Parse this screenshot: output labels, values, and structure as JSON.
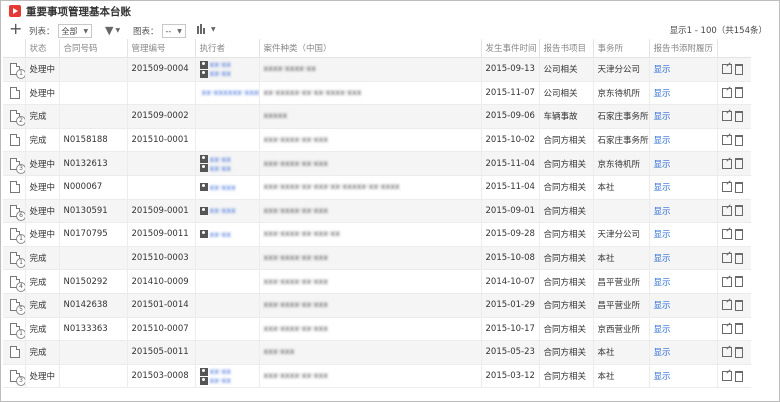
{
  "window": {
    "title": "重要事项管理基本台账"
  },
  "toolbar": {
    "list_label": "列表：",
    "list_value": "全部",
    "chart_label": "图表：",
    "chart_value": "--",
    "pagination": "显示1 - 100（共154条）"
  },
  "columns": [
    "状态",
    "合同号码",
    "管理编号",
    "执行者",
    "案件种类（中国）",
    "发生事件时间",
    "报告书项目",
    "事务所",
    "报告书添附履历"
  ],
  "rows": [
    {
      "badge": "1",
      "status": "处理中",
      "contract": "",
      "mgmt": "201509-0004",
      "execs": [
        "xx·xx",
        "xx·xx"
      ],
      "case": "xxxx·xxxx·xx",
      "date": "2015-09-13",
      "report": "公司相关",
      "office": "天津分公司",
      "attach": "显示"
    },
    {
      "badge": "",
      "status": "处理中",
      "contract": "",
      "mgmt": "",
      "execs": [
        "xx·xxxxxx·xxxxx"
      ],
      "case": "xx·xxxxx·xx·xx·xxxx·xxx",
      "date": "2015-11-07",
      "report": "公司相关",
      "office": "京东待机所",
      "attach": "显示"
    },
    {
      "badge": "2",
      "status": "完成",
      "contract": "",
      "mgmt": "201509-0002",
      "execs": [],
      "case": "xxxxx",
      "date": "2015-09-06",
      "report": "车辆事故",
      "office": "石家庄事务所",
      "attach": "显示"
    },
    {
      "badge": "",
      "status": "完成",
      "contract": "N0158188",
      "mgmt": "201510-0001",
      "execs": [],
      "case": "xxx·xxxx·xx·xxx",
      "date": "2015-10-02",
      "report": "合同方相关",
      "office": "石家庄事务所",
      "attach": "显示"
    },
    {
      "badge": "3",
      "status": "处理中",
      "contract": "N0132613",
      "mgmt": "",
      "execs": [
        "xx·xx",
        "xx·xx"
      ],
      "case": "xxx·xxxx·xx·xxx",
      "date": "2015-11-04",
      "report": "合同方相关",
      "office": "京东待机所",
      "attach": "显示"
    },
    {
      "badge": "",
      "status": "处理中",
      "contract": "N000067",
      "mgmt": "",
      "execs": [
        "xx·xxx"
      ],
      "case": "xxx·xxxx·xx·xxx·xx·xxxxx·xx·xxxx",
      "date": "2015-11-04",
      "report": "合同方相关",
      "office": "本社",
      "attach": "显示"
    },
    {
      "badge": "6",
      "status": "处理中",
      "contract": "N0130591",
      "mgmt": "201509-0001",
      "execs": [
        "xx·xxx"
      ],
      "case": "xxx·xxxx·xx·xxx",
      "date": "2015-09-01",
      "report": "合同方相关",
      "office": "",
      "attach": "显示"
    },
    {
      "badge": "1",
      "status": "处理中",
      "contract": "N0170795",
      "mgmt": "201509-0011",
      "execs": [
        "xx·xx"
      ],
      "case": "xxx·xxxx·xx·xxx·xx",
      "date": "2015-09-28",
      "report": "合同方相关",
      "office": "天津分公司",
      "attach": "显示"
    },
    {
      "badge": "1",
      "status": "完成",
      "contract": "",
      "mgmt": "201510-0003",
      "execs": [],
      "case": "xxx·xxxx·xx·xxx",
      "date": "2015-10-08",
      "report": "合同方相关",
      "office": "本社",
      "attach": "显示"
    },
    {
      "badge": "4",
      "status": "完成",
      "contract": "N0150292",
      "mgmt": "201410-0009",
      "execs": [],
      "case": "xxx·xxxx·xx·xxx",
      "date": "2014-10-07",
      "report": "合同方相关",
      "office": "昌平营业所",
      "attach": "显示"
    },
    {
      "badge": "5",
      "status": "完成",
      "contract": "N0142638",
      "mgmt": "201501-0014",
      "execs": [],
      "case": "xxx·xxxx·xx·xxx",
      "date": "2015-01-29",
      "report": "合同方相关",
      "office": "昌平营业所",
      "attach": "显示"
    },
    {
      "badge": "1",
      "status": "完成",
      "contract": "N0133363",
      "mgmt": "201510-0007",
      "execs": [],
      "case": "xxx·xxxx·xx·xxx",
      "date": "2015-10-17",
      "report": "合同方相关",
      "office": "京西营业所",
      "attach": "显示"
    },
    {
      "badge": "",
      "status": "完成",
      "contract": "",
      "mgmt": "201505-0011",
      "execs": [],
      "case": "xxx·xxx",
      "date": "2015-05-23",
      "report": "合同方相关",
      "office": "本社",
      "attach": "显示"
    },
    {
      "badge": "3",
      "status": "处理中",
      "contract": "",
      "mgmt": "201503-0008",
      "execs": [
        "xx·xx",
        "xx·xx"
      ],
      "case": "xxx·xxxx·xx·xxx",
      "date": "2015-03-12",
      "report": "合同方相关",
      "office": "本社",
      "attach": "显示"
    }
  ]
}
